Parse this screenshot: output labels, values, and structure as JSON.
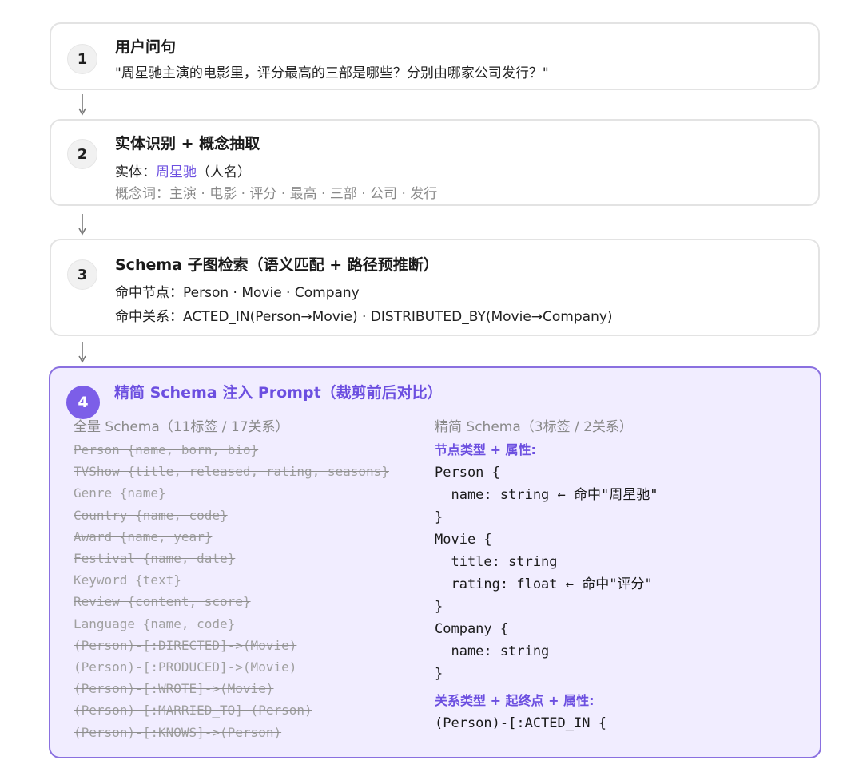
{
  "steps": [
    {
      "number": "1",
      "title": "用户问句",
      "lines": [
        "\"周星驰主演的电影里，评分最高的三部是哪些？分别由哪家公司发行？\""
      ]
    },
    {
      "number": "2",
      "title": "实体识别 + 概念抽取",
      "entity_prefix": "实体：",
      "entity_name": "周星驰",
      "entity_suffix": "（人名）",
      "concepts": "概念词：主演 · 电影 · 评分 · 最高 · 三部 · 公司 · 发行"
    },
    {
      "number": "3",
      "title": "Schema 子图检索（语义匹配 + 路径预推断）",
      "lines": [
        "命中节点：Person · Movie · Company",
        "命中关系：ACTED_IN(Person→Movie) · DISTRIBUTED_BY(Movie→Company)"
      ]
    },
    {
      "number": "4",
      "title": "精简 Schema 注入 Prompt（裁剪前后对比）"
    }
  ],
  "comparison": {
    "full_header": "全量 Schema（11标签 / 17关系）",
    "slim_header": "精简 Schema（3标签 / 2关系）",
    "full_items": [
      "Person {name, born, bio}",
      "TVShow {title, released, rating, seasons}",
      "Genre {name}",
      "Country {name, code}",
      "Award {name, year}",
      "Festival {name, date}",
      "Keyword {text}",
      "Review {content, score}",
      "Language {name, code}",
      "(Person)-[:DIRECTED]->(Movie)",
      "(Person)-[:PRODUCED]->(Movie)",
      "(Person)-[:WROTE]->(Movie)",
      "(Person)-[:MARRIED_TO]-(Person)",
      "(Person)-[:KNOWS]->(Person)"
    ],
    "node_section_label": "节点类型 + 属性:",
    "slim_code": [
      "Person {",
      "  name: string ← 命中\"周星驰\"",
      "}",
      "Movie {",
      "  title: string",
      "  rating: float ← 命中\"评分\"",
      "}",
      "Company {",
      "  name: string",
      "}"
    ],
    "rel_section_label": "关系类型 + 起终点 + 属性:",
    "rel_code": [
      "(Person)-[:ACTED_IN {"
    ]
  },
  "colors": {
    "accent": "#6c4fe0",
    "highlight_bg": "#f1edff",
    "highlight_border": "#8a70e0"
  }
}
